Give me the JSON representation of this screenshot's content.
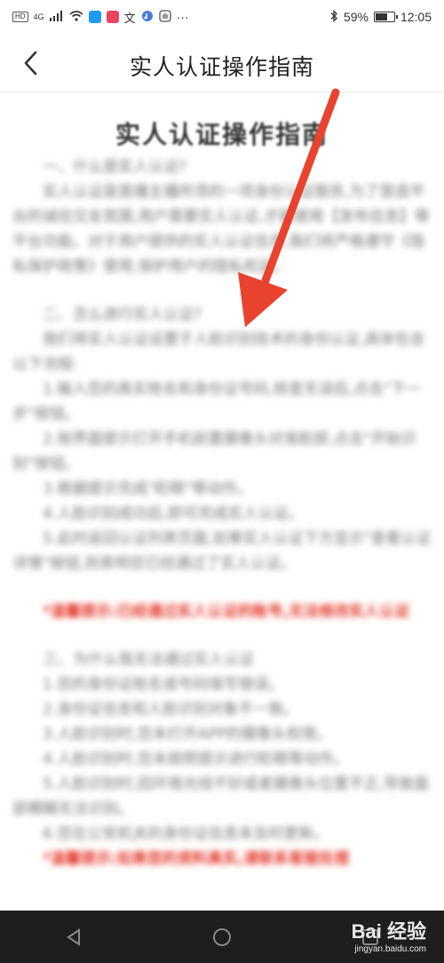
{
  "status_bar": {
    "network": "HD",
    "signal": "4G",
    "app_badge": "NOTES",
    "battery_pct": "59%",
    "time": "12:05",
    "more": "···"
  },
  "header": {
    "title": "实人认证操作指南",
    "back_icon": "chevron-left-icon"
  },
  "document": {
    "title": "实人认证操作指南",
    "lines": [
      {
        "text": "一、什么是实人认证?",
        "cls": "indent"
      },
      {
        "text": "实人认证是直播主播所须的一项身份认证服务,为了营造平台的诚信交友氛围,用户需要实人认证,才能使用【发布信息】等平台功能。对于用户提供的实人认证信息,我们将严格遵守《隐私保护政策》使用,保护用户的隐私权益。",
        "cls": "indent"
      },
      {
        "text": "",
        "cls": "gap"
      },
      {
        "text": "二、怎么进行实人认证?",
        "cls": "indent"
      },
      {
        "text": "我们将实人认证设置于人脸识别技术的身份认证,具体包含以下流程:",
        "cls": "indent"
      },
      {
        "text": "1.输入您的真实姓名和身份证号码,核查无误后,点击\"下一步\"按钮。",
        "cls": "indent"
      },
      {
        "text": "2.按界面提示打开手机前置摄像头对准脸部,点击\"开始识别\"按钮。",
        "cls": "indent"
      },
      {
        "text": "3.根据提示完成\"眨眼\"等动作。",
        "cls": "indent"
      },
      {
        "text": "4.人脸识别成功后,即可完成实人认证。",
        "cls": "indent"
      },
      {
        "text": "5.此时返回认证列表页面,如果实人认证下方显示\"查看认证详情\"按钮,则表明您已经通过了实人认证。",
        "cls": "indent"
      },
      {
        "text": "",
        "cls": "gap"
      },
      {
        "text": "*温馨提示:已经通过实人认证的账号,无法修改实人认证",
        "cls": "red indent"
      },
      {
        "text": "",
        "cls": "gap"
      },
      {
        "text": "三、为什么我无法通过实人认证",
        "cls": "indent"
      },
      {
        "text": "1.您的身份证姓名或号码填写错误。",
        "cls": "indent"
      },
      {
        "text": "2.身份证信息和人脸识别对象不一致。",
        "cls": "indent"
      },
      {
        "text": "3.人脸识别时,您未打开APP的摄像头权限。",
        "cls": "indent"
      },
      {
        "text": "4.人脸识别时,您未按照提示进行眨眼等动作。",
        "cls": "indent"
      },
      {
        "text": "5.人脸识别时,因环境光线不好或者摄像头位置不正,导致面部模糊无法识别。",
        "cls": "indent"
      },
      {
        "text": "6.您在公安机关的身份证信息未及时更新。",
        "cls": "indent"
      },
      {
        "text": "*温馨提示:如果您的资料真实,请联系客服处理",
        "cls": "red indent"
      }
    ]
  },
  "annotation": {
    "arrow_color": "#e8432f"
  },
  "watermark": {
    "brand": "Bai 经验",
    "url": "jingyan.baidu.com"
  }
}
